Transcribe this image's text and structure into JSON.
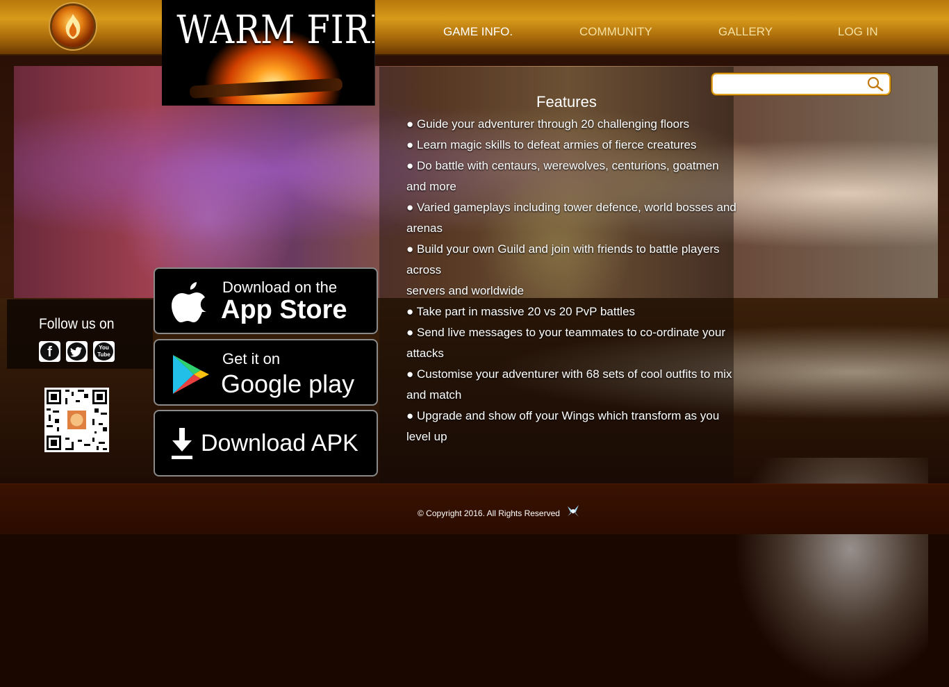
{
  "brand": {
    "title": "WARM FIRE"
  },
  "nav": {
    "items": [
      {
        "label": "GAME INFO."
      },
      {
        "label": "COMMUNITY"
      },
      {
        "label": "GALLERY"
      },
      {
        "label": "LOG IN"
      }
    ]
  },
  "search": {
    "placeholder": "",
    "value": "",
    "icon": "search-icon"
  },
  "features": {
    "title": "Features",
    "items": [
      "● Guide your adventurer through 20 challenging floors",
      "● Learn magic skills to defeat armies of fierce creatures",
      "● Do battle with centaurs, werewolves, centurions, goatmen and more",
      "● Varied gameplays including tower defence, world bosses and arenas",
      "● Build your own Guild and join with friends to battle players across",
      "servers and worldwide",
      "● Take part in massive 20 vs 20 PvP battles",
      "● Send live messages to your teammates to co-ordinate your attacks",
      "● Customise your adventurer with 68 sets of cool outfits to mix and match",
      "● Upgrade and show off your Wings which transform as you level up"
    ]
  },
  "social": {
    "title": "Follow us on",
    "icons": [
      "facebook-icon",
      "twitter-icon",
      "youtube-icon"
    ],
    "facebook_glyph": "f",
    "twitter_glyph": "t",
    "youtube_line1": "You",
    "youtube_line2": "Tube"
  },
  "stores": {
    "appstore": {
      "small": "Download on the",
      "big": "App Store"
    },
    "googleplay": {
      "small": "Get it on",
      "big": "Google play"
    },
    "apk": {
      "big": "Download APK"
    }
  },
  "footer": {
    "copyright": "© Copyright 2016. All Rights Reserved"
  },
  "colors": {
    "accent": "#d89a1a",
    "nav_active": "#ffffff",
    "nav_inactive": "#f6e0a0"
  }
}
